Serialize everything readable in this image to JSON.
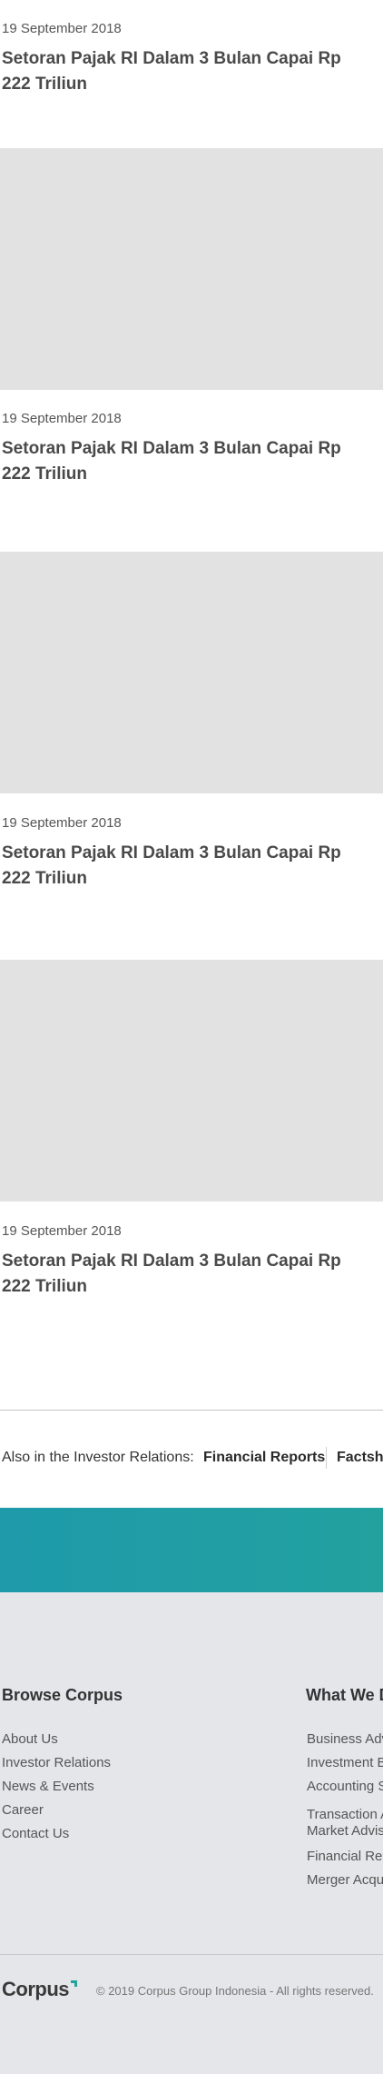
{
  "articles": [
    {
      "date": "19 September 2018",
      "title": "Setoran Pajak RI Dalam 3 Bulan Capai Rp 222 Triliun"
    },
    {
      "date": "19 September 2018",
      "title": "Setoran Pajak RI Dalam 3 Bulan Capai Rp 222 Triliun"
    },
    {
      "date": "19 September 2018",
      "title": "Setoran Pajak RI Dalam 3 Bulan Capai Rp 222 Triliun"
    },
    {
      "date": "19 September 2018",
      "title": "Setoran Pajak RI Dalam 3 Bulan Capai Rp 222 Triliun"
    }
  ],
  "investor_relations": {
    "label": "Also in the Investor Relations:",
    "links": [
      "Financial Reports",
      "Factsheet"
    ]
  },
  "footer": {
    "browse": {
      "title": "Browse Corpus",
      "links": [
        "About Us",
        "Investor Relations",
        "News & Events",
        "Career",
        "Contact Us"
      ]
    },
    "what_we_do": {
      "title": "What We Do",
      "links": [
        "Business Advisory",
        "Investment Banking",
        "Accounting Services",
        "Transaction Advisory & Capital",
        "Market Advisory",
        "Financial Reporting",
        "Merger Acquisition"
      ]
    },
    "logo": "Corpus",
    "copyright": "© 2019 Corpus Group Indonesia - All rights reserved."
  },
  "colors": {
    "banner_start": "#1e9aaa",
    "banner_end": "#22a19f",
    "footer_bg": "#e5e6ea",
    "thumb_bg": "#e2e2e2",
    "logo_accent": "#21a39a"
  }
}
